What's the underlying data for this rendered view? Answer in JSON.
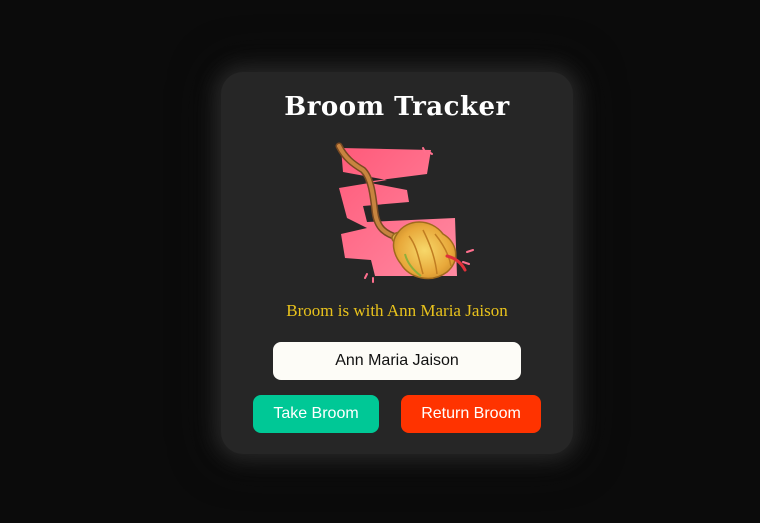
{
  "app": {
    "title": "Broom Tracker"
  },
  "illustration": {
    "icon": "broom-icon",
    "colors": {
      "splash": "#ff6f8e",
      "handle": "#b5703a",
      "bristles": "#f2c04a"
    }
  },
  "status": {
    "text": "Broom is with Ann Maria Jaison"
  },
  "name_input": {
    "value": "Ann Maria Jaison"
  },
  "buttons": {
    "take_label": "Take Broom",
    "return_label": "Return Broom"
  },
  "colors": {
    "background": "#0b0b0b",
    "card": "#262626",
    "status_text": "#e8c21c",
    "take_button": "#00c896",
    "return_button": "#ff3300"
  }
}
